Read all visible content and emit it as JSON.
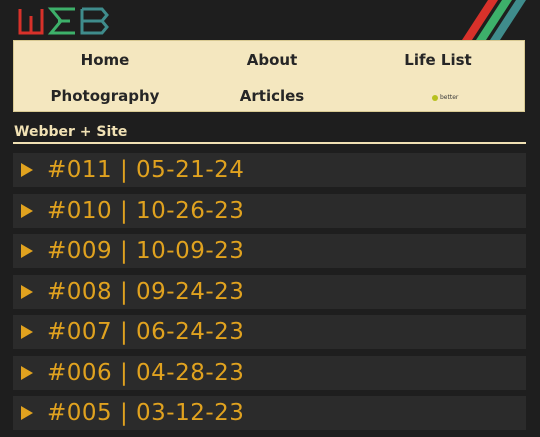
{
  "header": {
    "logo_text": "WEB",
    "colors": {
      "red": "#d8312a",
      "green": "#3db06a",
      "teal": "#3f8c8c"
    }
  },
  "nav": {
    "items": [
      {
        "label": "Home"
      },
      {
        "label": "About"
      },
      {
        "label": "Life List"
      },
      {
        "label": "Photography"
      },
      {
        "label": "Articles"
      }
    ],
    "badge_label": "better"
  },
  "site_title": "Webber + Site",
  "entries": [
    {
      "title": "#011 | 05-21-24"
    },
    {
      "title": "#010 | 10-26-23"
    },
    {
      "title": "#009 | 10-09-23"
    },
    {
      "title": "#008 | 09-24-23"
    },
    {
      "title": "#007 | 06-24-23"
    },
    {
      "title": "#006 | 04-28-23"
    },
    {
      "title": "#005 | 03-12-23"
    }
  ],
  "colors": {
    "accent": "#e0a21f",
    "nav_bg": "#f4e7bf",
    "page_bg": "#1e1e1e"
  }
}
